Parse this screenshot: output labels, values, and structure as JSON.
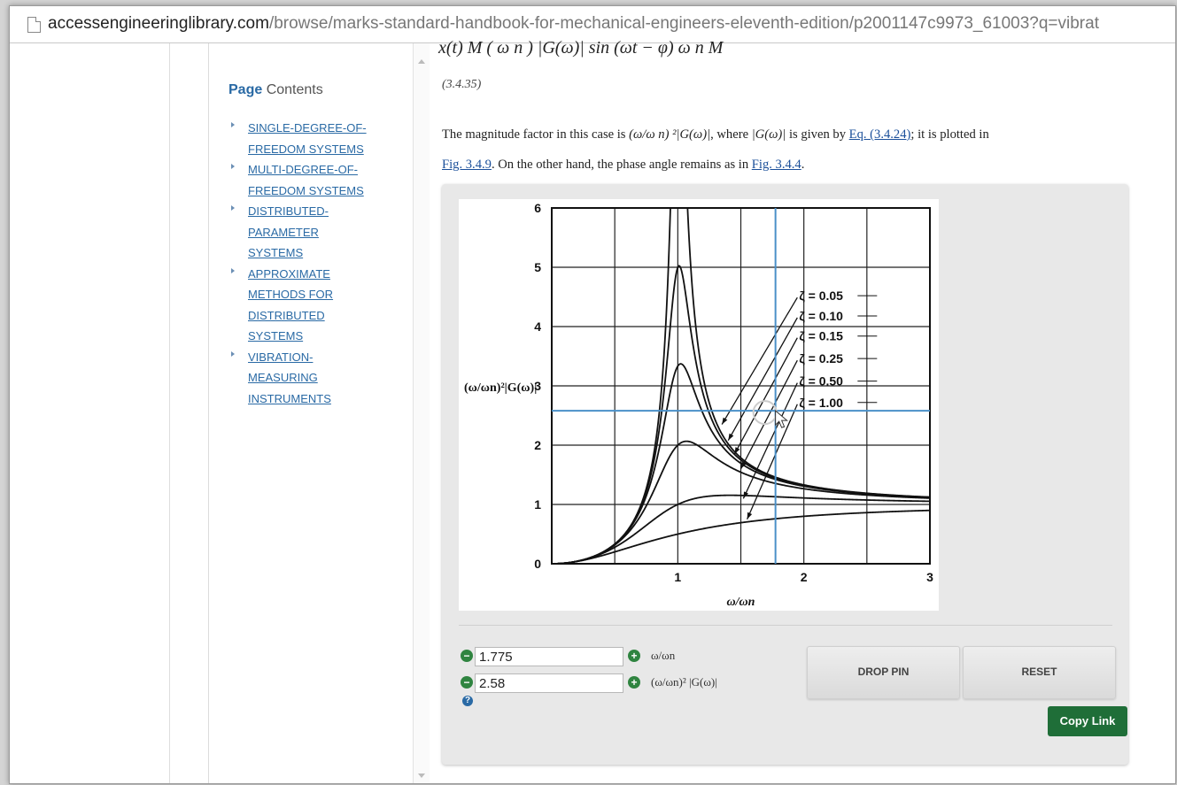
{
  "browser": {
    "url_domain": "accessengineeringlibrary.com",
    "url_path": "/browse/marks-standard-handbook-for-mechanical-engineers-eleventh-edition/p2001147c9973_61003?q=vibrat"
  },
  "sidebar": {
    "title_bold": "Page",
    "title_rest": " Contents",
    "items": [
      {
        "line1": "SINGLE-DEGREE-OF-",
        "line2": "FREEDOM SYSTEMS",
        "line3": ""
      },
      {
        "line1": "MULTI-DEGREE-OF-",
        "line2": "FREEDOM SYSTEMS",
        "line3": ""
      },
      {
        "line1": "DISTRIBUTED-",
        "line2": "PARAMETER",
        "line3": "SYSTEMS"
      },
      {
        "line1": "APPROXIMATE",
        "line2": "METHODS FOR",
        "line3": "DISTRIBUTED",
        "line4": "SYSTEMS"
      },
      {
        "line1": "VIBRATION-",
        "line2": "MEASURING",
        "line3": "INSTRUMENTS"
      }
    ]
  },
  "content": {
    "equation_top": "x(t)     M  ( ω n )  |G(ω)| sin (ωt  −  φ)      ω n        M",
    "equation_number": "(3.4.35)",
    "para_part1": "The magnitude factor in this case is ",
    "para_expr1": "(ω/ω n) ²|G(ω)|",
    "para_part2": ", where ",
    "para_expr2": "|G(ω)|",
    "para_part3": " is given by ",
    "link_eq": "Eq. (3.4.24)",
    "para_part4": "; it is plotted in ",
    "link_fig1": "Fig. 3.4.9",
    "para_part5": ". On the other hand, the phase angle remains as in ",
    "link_fig2": "Fig. 3.4.4",
    "para_part6": "."
  },
  "widget": {
    "x_value": "1.775",
    "y_value": "2.58",
    "x_label": "ω/ωn",
    "y_label": "(ω/ωn)² |G(ω)|",
    "drop_pin_label": "DROP PIN",
    "reset_label": "RESET",
    "copy_link_label": "Copy Link",
    "help_icon": "?",
    "minus_icon": "−",
    "plus_icon": "+"
  },
  "chart_data": {
    "type": "line",
    "xlabel": "ω/ωn",
    "ylabel": "(ω/ωn)²|G(ω)|",
    "xlim": [
      0,
      3
    ],
    "ylim": [
      0,
      6
    ],
    "xticks": [
      1,
      2,
      3
    ],
    "yticks": [
      0,
      1,
      2,
      3,
      4,
      5,
      6
    ],
    "grid": true,
    "crosshair": {
      "x": 1.775,
      "y": 2.58
    },
    "series": [
      {
        "name": "ζ = 0.05",
        "zeta": 0.05
      },
      {
        "name": "ζ = 0.10",
        "zeta": 0.1
      },
      {
        "name": "ζ = 0.15",
        "zeta": 0.15
      },
      {
        "name": "ζ = 0.25",
        "zeta": 0.25
      },
      {
        "name": "ζ = 0.50",
        "zeta": 0.5
      },
      {
        "name": "ζ = 1.00",
        "zeta": 1.0
      }
    ],
    "annotation_targets": [
      {
        "x": 1.35,
        "y": 2.35
      },
      {
        "x": 1.4,
        "y": 2.08
      },
      {
        "x": 1.45,
        "y": 1.85
      },
      {
        "x": 1.5,
        "y": 1.6
      },
      {
        "x": 1.52,
        "y": 1.1
      },
      {
        "x": 1.55,
        "y": 0.75
      }
    ]
  }
}
